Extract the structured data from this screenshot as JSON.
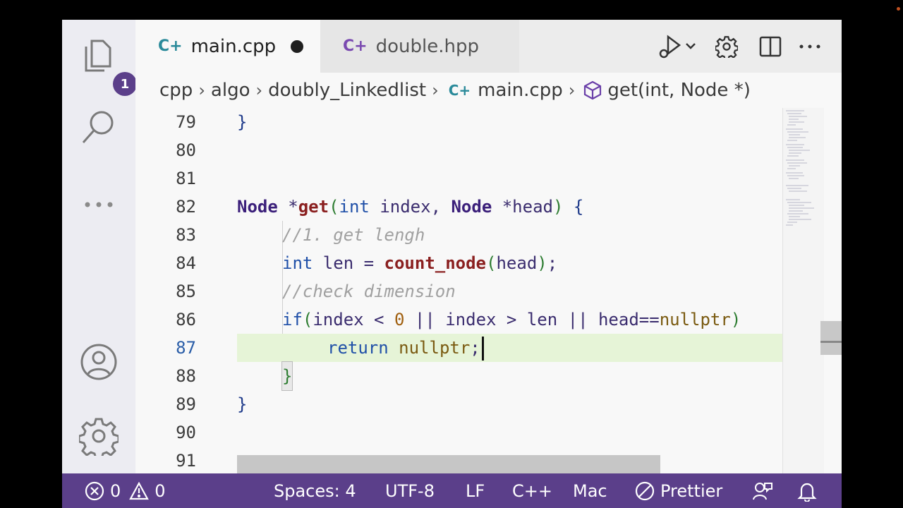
{
  "tabs": [
    {
      "label": "main.cpp",
      "active": true,
      "modified": true,
      "icon": "cpp-icon"
    },
    {
      "label": "double.hpp",
      "active": false,
      "modified": false,
      "icon": "cpp-icon"
    }
  ],
  "toolbar": {
    "icons": [
      "run-debug-icon",
      "chevron-down-icon",
      "gear-icon",
      "split-editor-icon",
      "more-actions-icon"
    ]
  },
  "activity_bar": {
    "explorer_badge": "1",
    "icons": [
      "explorer-icon",
      "search-icon",
      "more-icon",
      "account-icon",
      "settings-gear-icon"
    ]
  },
  "breadcrumb": {
    "items": [
      "cpp",
      "algo",
      "doubly_Linkedlist",
      "main.cpp",
      "get(int, Node *)"
    ]
  },
  "editor": {
    "current_line": "87",
    "lines": [
      {
        "n": "79"
      },
      {
        "n": "80"
      },
      {
        "n": "81"
      },
      {
        "n": "82"
      },
      {
        "n": "83"
      },
      {
        "n": "84"
      },
      {
        "n": "85"
      },
      {
        "n": "86"
      },
      {
        "n": "87"
      },
      {
        "n": "88"
      },
      {
        "n": "89"
      },
      {
        "n": "90"
      },
      {
        "n": "91"
      }
    ],
    "code": {
      "l79": "}",
      "l82_type1": "Node",
      "l82_star1": " *",
      "l82_fn": "get",
      "l82_open": "(",
      "l82_int": "int",
      "l82_index": " index, ",
      "l82_type2": "Node",
      "l82_star2": " *",
      "l82_head": "head",
      "l82_close": ")",
      "l82_brace": " {",
      "l83": "//1. get lengh",
      "l84_int": "int",
      "l84_len": " len = ",
      "l84_fn": "count_node",
      "l84_open": "(",
      "l84_arg": "head",
      "l84_close": ")",
      "l84_end": ";",
      "l85": "//check dimension",
      "l86_if": "if",
      "l86_open": "(",
      "l86_a": "index",
      "l86_lt": " < ",
      "l86_zero": "0",
      "l86_or1": " || ",
      "l86_b": "index",
      "l86_gt": " > ",
      "l86_len": "len",
      "l86_or2": " || ",
      "l86_head": "head",
      "l86_eq": "==",
      "l86_np": "nullptr",
      "l86_close": ")",
      "l87_ret": "return",
      "l87_np": " nullptr",
      "l87_end": ";",
      "l88": "}",
      "l89": "}"
    }
  },
  "statusbar": {
    "errors": "0",
    "warnings": "0",
    "spaces": "Spaces: 4",
    "encoding": "UTF-8",
    "eol": "LF",
    "language": "C++",
    "platform": "Mac",
    "formatter": "Prettier"
  },
  "colors": {
    "accent": "#5b3f8a",
    "current_line": "#e6f4d7"
  }
}
